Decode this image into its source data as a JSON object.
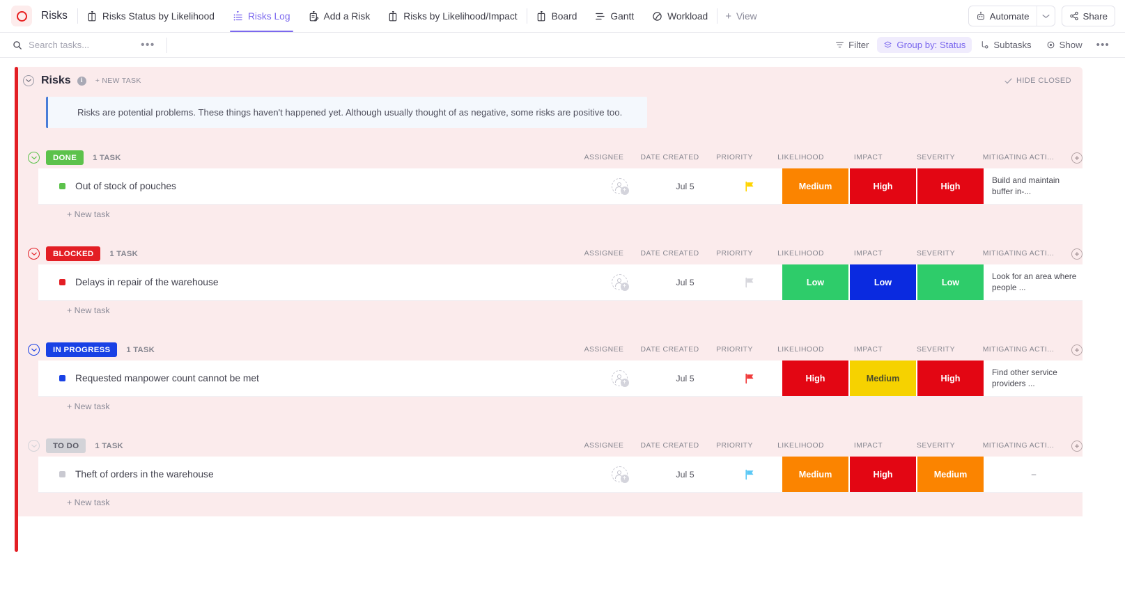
{
  "topbar": {
    "logo_icon": "clickup-o-icon",
    "space_title": "Risks",
    "tabs": [
      {
        "label": "Risks Status by Likelihood",
        "icon": "board-icon",
        "active": false
      },
      {
        "label": "Risks Log",
        "icon": "list-icon",
        "active": true
      },
      {
        "label": "Add a Risk",
        "icon": "form-icon",
        "active": false
      },
      {
        "label": "Risks by Likelihood/Impact",
        "icon": "board-icon",
        "active": false
      },
      {
        "label": "Board",
        "icon": "board-icon",
        "active": false
      },
      {
        "label": "Gantt",
        "icon": "gantt-icon",
        "active": false
      },
      {
        "label": "Workload",
        "icon": "workload-icon",
        "active": false
      }
    ],
    "add_view_label": "View",
    "automate_label": "Automate",
    "share_label": "Share"
  },
  "toolbar": {
    "search_placeholder": "Search tasks...",
    "search_value": "",
    "more_label": "•••",
    "filter_label": "Filter",
    "group_by_label": "Group by: Status",
    "subtasks_label": "Subtasks",
    "show_label": "Show",
    "overflow_label": "•••"
  },
  "panel": {
    "title": "Risks",
    "new_task_label": "+ NEW TASK",
    "hide_closed_label": "HIDE CLOSED",
    "description": "Risks are potential problems. These things haven't happened yet. Although usually thought of as negative, some risks are positive too.",
    "accent_color": "#e31e24"
  },
  "columns": {
    "assignee": "ASSIGNEE",
    "date_created": "DATE CREATED",
    "priority": "PRIORITY",
    "likelihood": "LIKELIHOOD",
    "impact": "IMPACT",
    "severity": "SEVERITY",
    "mitigating": "MITIGATING ACTI..."
  },
  "new_task_label": "+ New task",
  "colors": {
    "done": "#5cc24b",
    "blocked": "#e31e24",
    "in_progress": "#1941e5",
    "todo": "#d3d3d8",
    "high": "#e30613",
    "medium": "#fb8400",
    "medium_yellow": "#f6d200",
    "low_green": "#2ecc6a",
    "low_blue": "#0a2ae0"
  },
  "groups": [
    {
      "status": "DONE",
      "status_color": "#5cc24b",
      "status_text_color": "#ffffff",
      "count": "1 TASK",
      "tasks": [
        {
          "title": "Out of stock of pouches",
          "marker_color": "#5cc24b",
          "assignee": "",
          "date_created": "Jul 5",
          "priority_flag_color": "#ffd400",
          "likelihood": {
            "label": "Medium",
            "bg": "#fb8400",
            "fg": "#ffffff"
          },
          "impact": {
            "label": "High",
            "bg": "#e30613",
            "fg": "#ffffff"
          },
          "severity": {
            "label": "High",
            "bg": "#e30613",
            "fg": "#ffffff"
          },
          "mitigating": "Build and maintain buffer in-..."
        }
      ]
    },
    {
      "status": "BLOCKED",
      "status_color": "#e31e24",
      "status_text_color": "#ffffff",
      "count": "1 TASK",
      "tasks": [
        {
          "title": "Delays in repair of the warehouse",
          "marker_color": "#e31e24",
          "assignee": "",
          "date_created": "Jul 5",
          "priority_flag_color": "#d6d6dc",
          "likelihood": {
            "label": "Low",
            "bg": "#2ecc6a",
            "fg": "#ffffff"
          },
          "impact": {
            "label": "Low",
            "bg": "#0a2ae0",
            "fg": "#ffffff"
          },
          "severity": {
            "label": "Low",
            "bg": "#2ecc6a",
            "fg": "#ffffff"
          },
          "mitigating": "Look for an area where people ..."
        }
      ]
    },
    {
      "status": "IN PROGRESS",
      "status_color": "#1941e5",
      "status_text_color": "#ffffff",
      "count": "1 TASK",
      "tasks": [
        {
          "title": "Requested manpower count cannot be met",
          "marker_color": "#1941e5",
          "assignee": "",
          "date_created": "Jul 5",
          "priority_flag_color": "#f03a3a",
          "likelihood": {
            "label": "High",
            "bg": "#e30613",
            "fg": "#ffffff"
          },
          "impact": {
            "label": "Medium",
            "bg": "#f6d200",
            "fg": "#4d4d2a"
          },
          "severity": {
            "label": "High",
            "bg": "#e30613",
            "fg": "#ffffff"
          },
          "mitigating": "Find other service providers ..."
        }
      ]
    },
    {
      "status": "TO DO",
      "status_color": "#d3d3d8",
      "status_text_color": "#5a5a66",
      "count": "1 TASK",
      "tasks": [
        {
          "title": "Theft of orders in the warehouse",
          "marker_color": "#c9c9d1",
          "assignee": "",
          "date_created": "Jul 5",
          "priority_flag_color": "#5bc8f5",
          "likelihood": {
            "label": "Medium",
            "bg": "#fb8400",
            "fg": "#ffffff"
          },
          "impact": {
            "label": "High",
            "bg": "#e30613",
            "fg": "#ffffff"
          },
          "severity": {
            "label": "Medium",
            "bg": "#fb8400",
            "fg": "#ffffff"
          },
          "mitigating": "–"
        }
      ]
    }
  ]
}
